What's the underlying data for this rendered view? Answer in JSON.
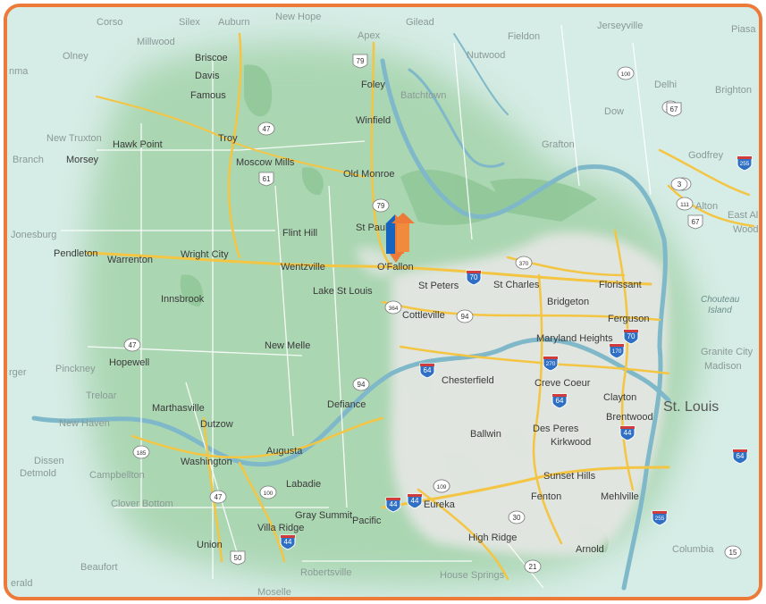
{
  "map": {
    "brand_color": "#ee7a3a",
    "center_marker_icon": "house-pin-icon",
    "cities_major": [
      {
        "name": "St. Louis"
      }
    ],
    "cities": [
      {
        "name": "Corso"
      },
      {
        "name": "Silex"
      },
      {
        "name": "Auburn"
      },
      {
        "name": "New Hope"
      },
      {
        "name": "Gilead"
      },
      {
        "name": "Jerseyville"
      },
      {
        "name": "Piasa"
      },
      {
        "name": "Millwood"
      },
      {
        "name": "Apex"
      },
      {
        "name": "Fieldon"
      },
      {
        "name": "Olney"
      },
      {
        "name": "Briscoe"
      },
      {
        "name": "Nutwood"
      },
      {
        "name": "Davis"
      },
      {
        "name": "Foley"
      },
      {
        "name": "Delhi"
      },
      {
        "name": "Brighton"
      },
      {
        "name": "Famous"
      },
      {
        "name": "Batchtown"
      },
      {
        "name": "Dow"
      },
      {
        "name": "New Truxton"
      },
      {
        "name": "Winfield"
      },
      {
        "name": "Troy"
      },
      {
        "name": "Hawk Point"
      },
      {
        "name": "Grafton"
      },
      {
        "name": "Godfrey"
      },
      {
        "name": "Branch"
      },
      {
        "name": "Morsey"
      },
      {
        "name": "Moscow Mills"
      },
      {
        "name": "Old Monroe"
      },
      {
        "name": "Alton"
      },
      {
        "name": "East Al"
      },
      {
        "name": "Wood"
      },
      {
        "name": "Jonesburg"
      },
      {
        "name": "Flint Hill"
      },
      {
        "name": "St Paul"
      },
      {
        "name": "Pendleton"
      },
      {
        "name": "Wright City"
      },
      {
        "name": "Warrenton"
      },
      {
        "name": "Wentzville"
      },
      {
        "name": "O'Fallon"
      },
      {
        "name": "St Charles"
      },
      {
        "name": "Florissant"
      },
      {
        "name": "St Peters"
      },
      {
        "name": "Lake St Louis"
      },
      {
        "name": "Innsbrook"
      },
      {
        "name": "Bridgeton"
      },
      {
        "name": "Cottleville"
      },
      {
        "name": "Ferguson"
      },
      {
        "name": "New Melle"
      },
      {
        "name": "Maryland Heights"
      },
      {
        "name": "Hopewell"
      },
      {
        "name": "Pinckney"
      },
      {
        "name": "Granite City"
      },
      {
        "name": "Madison"
      },
      {
        "name": "Chesterfield"
      },
      {
        "name": "Creve Coeur"
      },
      {
        "name": "Defiance"
      },
      {
        "name": "Treloar"
      },
      {
        "name": "Clayton"
      },
      {
        "name": "Marthasville"
      },
      {
        "name": "Brentwood"
      },
      {
        "name": "New Haven"
      },
      {
        "name": "Dutzow"
      },
      {
        "name": "Ballwin"
      },
      {
        "name": "Des Peres"
      },
      {
        "name": "Kirkwood"
      },
      {
        "name": "Augusta"
      },
      {
        "name": "Dissen"
      },
      {
        "name": "Washington"
      },
      {
        "name": "Detmold"
      },
      {
        "name": "Campbellton"
      },
      {
        "name": "Labadie"
      },
      {
        "name": "Sunset Hills"
      },
      {
        "name": "Clover Bottom"
      },
      {
        "name": "Eureka"
      },
      {
        "name": "Fenton"
      },
      {
        "name": "Mehlville"
      },
      {
        "name": "Gray Summit"
      },
      {
        "name": "Villa Ridge"
      },
      {
        "name": "Pacific"
      },
      {
        "name": "Union"
      },
      {
        "name": "High Ridge"
      },
      {
        "name": "Arnold"
      },
      {
        "name": "Columbia"
      },
      {
        "name": "Beaufort"
      },
      {
        "name": "Robertsville"
      },
      {
        "name": "House Springs"
      },
      {
        "name": "erald"
      },
      {
        "name": "Moselle"
      },
      {
        "name": "rger"
      },
      {
        "name": "nma"
      }
    ],
    "water_labels": [
      {
        "name": "Chouteau Island"
      }
    ],
    "highway_shields": [
      {
        "num": "79",
        "type": "us"
      },
      {
        "num": "47",
        "type": "state"
      },
      {
        "num": "61",
        "type": "us"
      },
      {
        "num": "79",
        "type": "state"
      },
      {
        "num": "100",
        "type": "state"
      },
      {
        "num": "100",
        "type": "state"
      },
      {
        "num": "67",
        "type": "us"
      },
      {
        "num": "255",
        "type": "interstate"
      },
      {
        "num": "3",
        "type": "state"
      },
      {
        "num": "111",
        "type": "state"
      },
      {
        "num": "67",
        "type": "us"
      },
      {
        "num": "370",
        "type": "state"
      },
      {
        "num": "70",
        "type": "interstate"
      },
      {
        "num": "364",
        "type": "state"
      },
      {
        "num": "94",
        "type": "state"
      },
      {
        "num": "70",
        "type": "interstate"
      },
      {
        "num": "170",
        "type": "interstate"
      },
      {
        "num": "270",
        "type": "interstate"
      },
      {
        "num": "64",
        "type": "interstate"
      },
      {
        "num": "47",
        "type": "state"
      },
      {
        "num": "94",
        "type": "state"
      },
      {
        "num": "64",
        "type": "interstate"
      },
      {
        "num": "44",
        "type": "interstate"
      },
      {
        "num": "185",
        "type": "state"
      },
      {
        "num": "109",
        "type": "state"
      },
      {
        "num": "47",
        "type": "state"
      },
      {
        "num": "100",
        "type": "state"
      },
      {
        "num": "44",
        "type": "interstate"
      },
      {
        "num": "44",
        "type": "interstate"
      },
      {
        "num": "30",
        "type": "state"
      },
      {
        "num": "255",
        "type": "interstate"
      },
      {
        "num": "50",
        "type": "us"
      },
      {
        "num": "44",
        "type": "interstate"
      },
      {
        "num": "21",
        "type": "state"
      },
      {
        "num": "67",
        "type": "us"
      },
      {
        "num": "3",
        "type": "state"
      },
      {
        "num": "64",
        "type": "interstate"
      },
      {
        "num": "15",
        "type": "state"
      },
      {
        "num": "109",
        "type": "state"
      }
    ]
  }
}
